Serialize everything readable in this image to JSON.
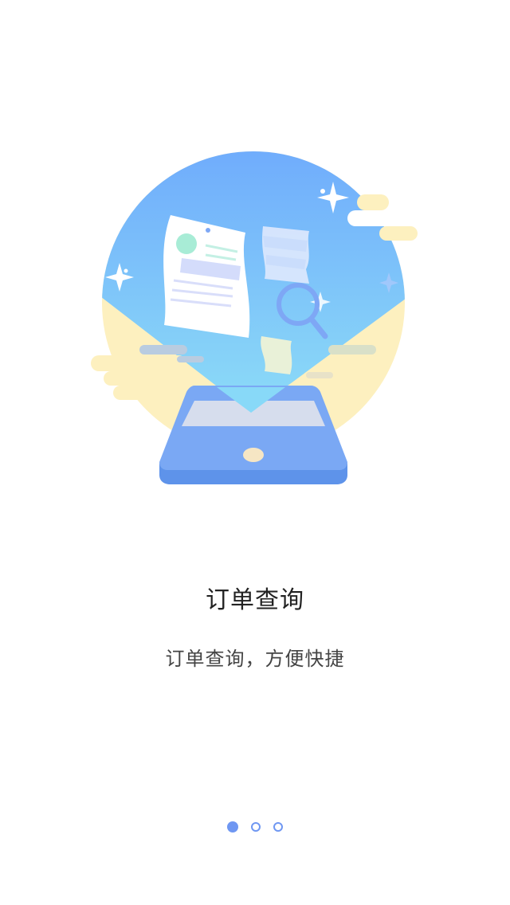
{
  "onboarding": {
    "title": "订单查询",
    "subtitle": "订单查询，方便快捷",
    "illustration_icon": "order-search-phone-illustration",
    "pager": {
      "total_pages": 3,
      "current_page": 1,
      "active_color": "#6f97f2"
    }
  },
  "colors": {
    "sky_top": "#6fabfc",
    "sky_bottom": "#88d9f8",
    "sun_yellow": "#fdf0bf",
    "phone_blue": "#7aa7f3",
    "phone_dark": "#5c8fe6"
  }
}
